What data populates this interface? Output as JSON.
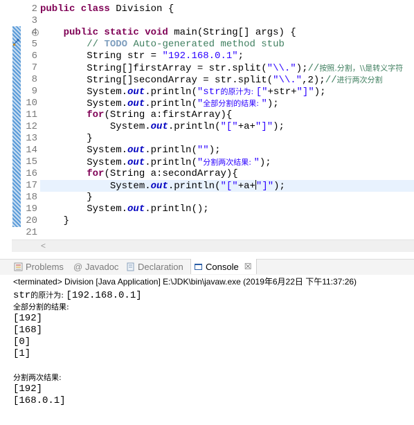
{
  "editor": {
    "line_numbers": [
      "2",
      "3",
      "4",
      "5",
      "6",
      "7",
      "8",
      "9",
      "10",
      "11",
      "12",
      "13",
      "14",
      "15",
      "16",
      "17",
      "18",
      "19",
      "20",
      "21"
    ],
    "lines": {
      "l2": {
        "kw1": "public class ",
        "txt": "Division {"
      },
      "l4": {
        "kw1": "public static void ",
        "txt": "main(String[] args) {"
      },
      "l5": {
        "c1": "// ",
        "task": "TODO",
        "c2": " Auto-generated method stub"
      },
      "l6": {
        "t1": "String str = ",
        "s1": "\"192.168.0.1\"",
        "t2": ";"
      },
      "l7": {
        "t1": "String[]firstArray = str.split(",
        "s1": "\"\\\\.\"",
        "t2": ");",
        "c1": "//",
        "z1": "按照.分割，\\\\是转义字符"
      },
      "l8": {
        "t1": "String[]secondArray = str.split(",
        "s1": "\"\\\\.\"",
        "t2": ",2);",
        "c1": "//",
        "z1": "进行两次分割"
      },
      "l9": {
        "t1": "System.",
        "f1": "out",
        "t2": ".println(",
        "s1": "\"str",
        "z1": "的原汁为: ",
        "s2": "[\"",
        "t3": "+str+",
        "s3": "\"]\"",
        "t4": ");"
      },
      "l10": {
        "t1": "System.",
        "f1": "out",
        "t2": ".println(",
        "s1": "\"",
        "z1": "全部分割的结果: ",
        "s2": "\"",
        "t3": ");"
      },
      "l11": {
        "kw1": "for",
        "t1": "(String a:firstArray){"
      },
      "l12": {
        "t1": "System.",
        "f1": "out",
        "t2": ".println(",
        "s1": "\"[\"",
        "t3": "+a+",
        "s2": "\"]\"",
        "t4": ");"
      },
      "l13": {
        "t1": "}"
      },
      "l14": {
        "t1": "System.",
        "f1": "out",
        "t2": ".println(",
        "s1": "\"\"",
        "t3": ");"
      },
      "l15": {
        "t1": "System.",
        "f1": "out",
        "t2": ".println(",
        "s1": "\"",
        "z1": "分割两次结果: ",
        "s2": "\"",
        "t3": ");"
      },
      "l16": {
        "kw1": "for",
        "t1": "(String a:secondArray){"
      },
      "l17": {
        "t1": "System.",
        "f1": "out",
        "t2": ".println(",
        "s1": "\"[\"",
        "t3": "+a+",
        "s2": "\"]\"",
        "t4": ");"
      },
      "l18": {
        "t1": "}"
      },
      "l19": {
        "t1": "System.",
        "f1": "out",
        "t2": ".println();"
      },
      "l20": {
        "t1": "}"
      }
    }
  },
  "views": {
    "tabs": [
      {
        "label": "Problems",
        "icon": "problems-icon"
      },
      {
        "label": "Javadoc",
        "icon": "at-icon"
      },
      {
        "label": "Declaration",
        "icon": "declaration-icon"
      },
      {
        "label": "Console",
        "icon": "console-icon"
      }
    ],
    "active_tab": "Console",
    "close_glyph": "☒"
  },
  "console": {
    "status": "<terminated> Division [Java Application] E:\\JDK\\bin\\javaw.exe (2019年6月22日 下午11:37:26)",
    "output": [
      {
        "a": "str",
        "z": "的原汁为: ",
        "b": "[192.168.0.1]"
      },
      {
        "a": "",
        "z": "全部分割的结果:",
        "b": ""
      },
      {
        "a": "[192]",
        "z": "",
        "b": ""
      },
      {
        "a": "[168]",
        "z": "",
        "b": ""
      },
      {
        "a": "[0]",
        "z": "",
        "b": ""
      },
      {
        "a": "[1]",
        "z": "",
        "b": ""
      },
      {
        "a": "",
        "z": "",
        "b": ""
      },
      {
        "a": "",
        "z": "分割两次结果:",
        "b": ""
      },
      {
        "a": "[192]",
        "z": "",
        "b": ""
      },
      {
        "a": "[168.0.1]",
        "z": "",
        "b": ""
      }
    ]
  },
  "colors": {
    "keyword": "#7f0055",
    "string": "#2a00ff",
    "comment": "#3f7f5f",
    "field": "#0000c0",
    "task": "#7f9fbf",
    "change_bar": "#5a9bd8",
    "current_line": "#e8f2fe"
  }
}
